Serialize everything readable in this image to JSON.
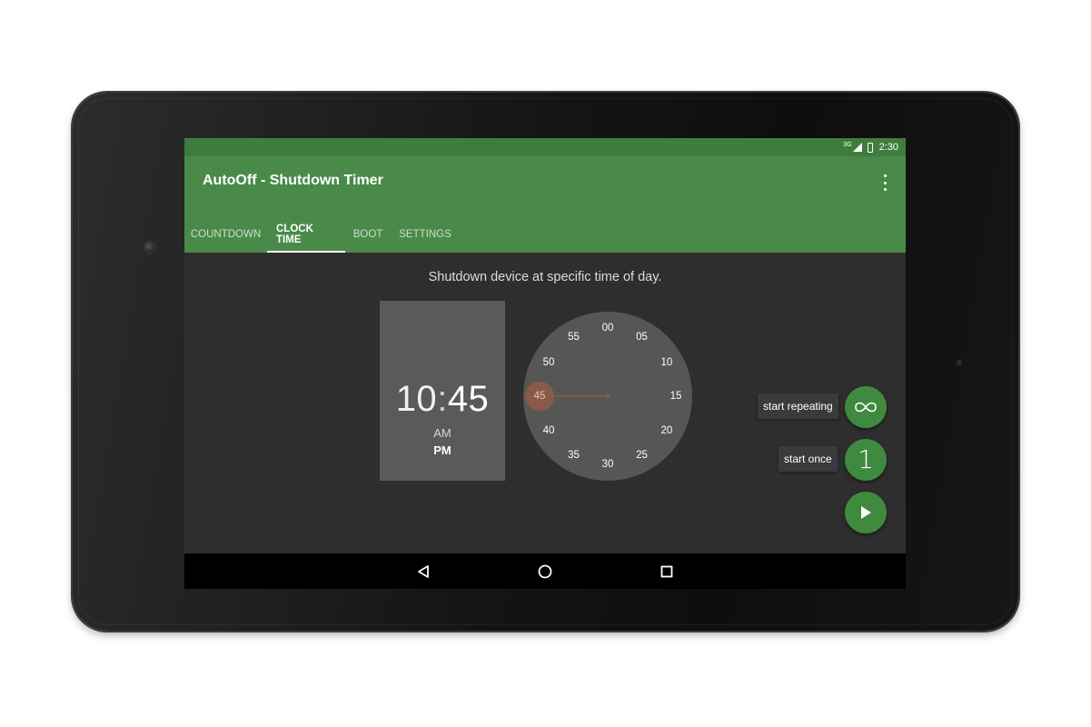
{
  "status_bar": {
    "network_label": "3G",
    "time": "2:30"
  },
  "app": {
    "title": "AutoOff - Shutdown Timer",
    "overflow_icon": "more-vert-icon",
    "accent_color": "#4a8a49"
  },
  "tabs": [
    {
      "label": "COUNTDOWN",
      "active": false
    },
    {
      "label": "CLOCK TIME",
      "active": true
    },
    {
      "label": "BOOT",
      "active": false
    },
    {
      "label": "SETTINGS",
      "active": false
    }
  ],
  "main": {
    "subtitle": "Shutdown device at specific time of day.",
    "time": {
      "hour": "10",
      "separator": ":",
      "minute": "45",
      "am_label": "AM",
      "pm_label": "PM",
      "selected_period": "PM"
    },
    "clock": {
      "mode": "minutes",
      "selected_minute": 45,
      "selected_label": "45",
      "labels": [
        "00",
        "05",
        "10",
        "15",
        "20",
        "25",
        "30",
        "35",
        "40",
        "45",
        "50",
        "55"
      ]
    }
  },
  "actions": {
    "start_repeating_label": "start repeating",
    "start_once_label": "start once",
    "start_once_glyph": "1",
    "repeat_icon": "infinity-icon",
    "play_icon": "play-icon",
    "fab_color": "#3f8a3f"
  },
  "nav": {
    "back_icon": "back-icon",
    "home_icon": "home-icon",
    "recents_icon": "recents-icon"
  }
}
